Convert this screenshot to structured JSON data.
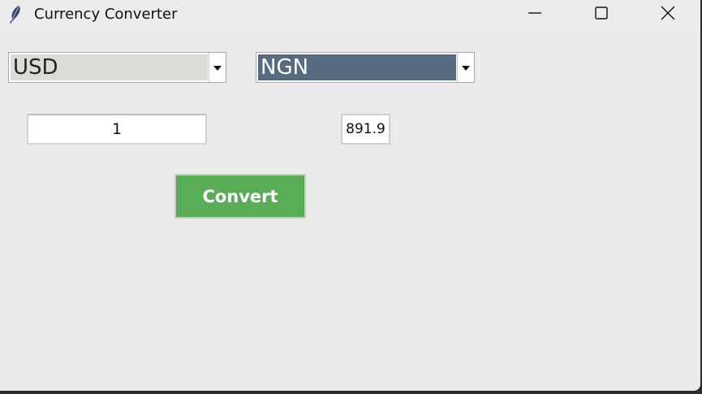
{
  "window": {
    "title": "Currency Converter",
    "icon": "feather-icon",
    "controls": [
      "minimize-icon",
      "maximize-icon",
      "close-icon"
    ]
  },
  "from_currency": {
    "selected": "USD"
  },
  "to_currency": {
    "selected": "NGN"
  },
  "amount": {
    "value": "1"
  },
  "result": {
    "value": "891.9"
  },
  "convert_button": {
    "label": "Convert",
    "color": "#5aad57"
  },
  "colors": {
    "window_bg": "#ebebeb",
    "selected_combo_bg": "#566a80"
  }
}
